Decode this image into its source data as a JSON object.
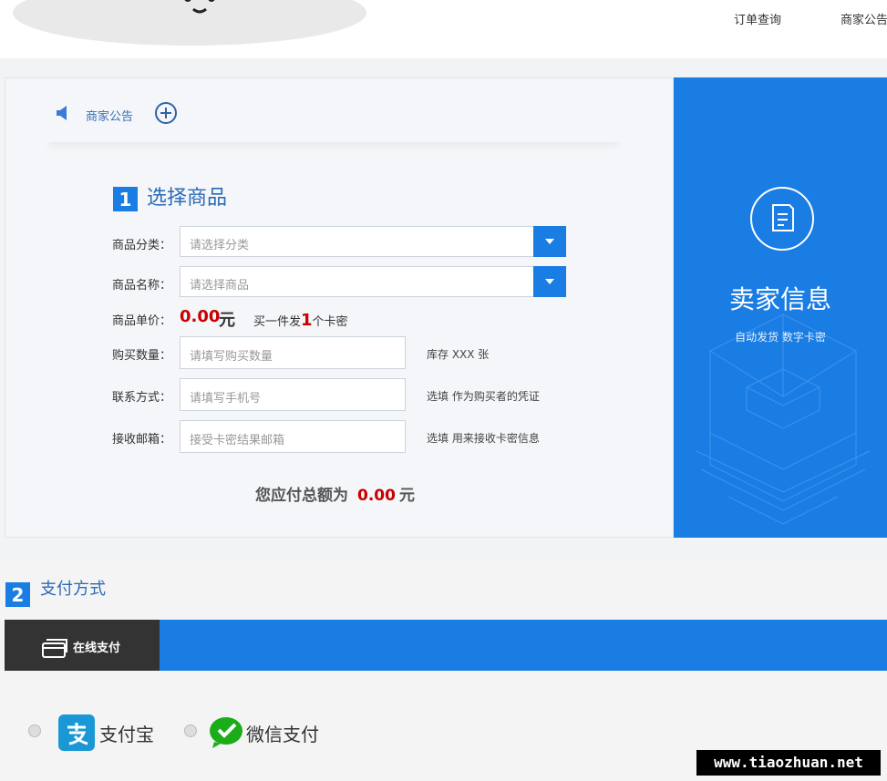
{
  "header": {
    "nav": [
      {
        "label": "订单查询"
      },
      {
        "label": "商家公告"
      }
    ]
  },
  "notice": {
    "label": "商家公告"
  },
  "step1": {
    "number": "1",
    "title": "选择商品",
    "category": {
      "label": "商品分类：",
      "placeholder": "请选择分类"
    },
    "product": {
      "label": "商品名称：",
      "placeholder": "请选择商品"
    },
    "price": {
      "label": "商品单价：",
      "value": "0.00",
      "unit": "元",
      "note_prefix": "买一件发",
      "note_count": "1",
      "note_suffix": "个卡密"
    },
    "quantity": {
      "label": "购买数量：",
      "placeholder": "请填写购买数量",
      "hint": "库存 XXX 张"
    },
    "contact": {
      "label": "联系方式：",
      "placeholder": "请填写手机号",
      "hint": "选填 作为购买者的凭证"
    },
    "email": {
      "label": "接收邮箱：",
      "placeholder": "接受卡密结果邮箱",
      "hint": "选填 用来接收卡密信息"
    },
    "total": {
      "label": "您应付总额为",
      "value": "0.00",
      "unit": "元"
    }
  },
  "seller": {
    "title": "卖家信息",
    "tags": "自动发货 数字卡密"
  },
  "step2": {
    "number": "2",
    "title": "支付方式",
    "tab_label": "在线支付",
    "methods": [
      {
        "label": "支付宝",
        "icon": "alipay-icon"
      },
      {
        "label": "微信支付",
        "icon": "wechat-icon"
      }
    ]
  },
  "watermark": "www.tiaozhuan.net",
  "colors": {
    "primary": "#1a7de3",
    "price": "#c80000",
    "dark_tab": "#333333"
  }
}
